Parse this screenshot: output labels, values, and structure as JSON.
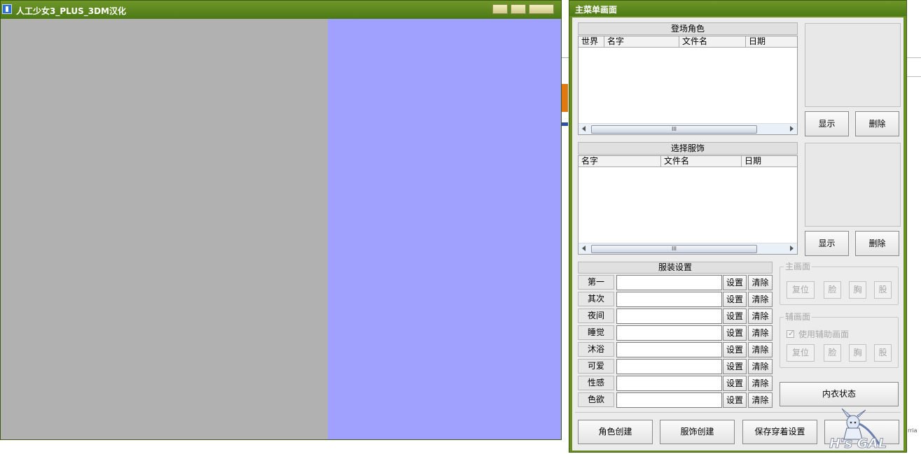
{
  "game_window": {
    "title": "人工少女3_PLUS_3DM汉化",
    "panes": {
      "left_color": "#b1b1b1",
      "right_color": "#a0a0ff"
    }
  },
  "menu_window": {
    "title": "主菜单画面",
    "characters": {
      "header": "登场角色",
      "columns": [
        "世界",
        "名字",
        "文件名",
        "日期"
      ],
      "rows": [],
      "show_button": "显示",
      "delete_button": "删除"
    },
    "outfits": {
      "header": "选择服饰",
      "columns": [
        "名字",
        "文件名",
        "日期"
      ],
      "rows": [],
      "show_button": "显示",
      "delete_button": "删除"
    },
    "clothing_settings": {
      "header": "服装设置",
      "set_label": "设置",
      "clear_label": "清除",
      "rows": [
        {
          "label": "第一",
          "value": ""
        },
        {
          "label": "其次",
          "value": ""
        },
        {
          "label": "夜间",
          "value": ""
        },
        {
          "label": "睡觉",
          "value": ""
        },
        {
          "label": "沐浴",
          "value": ""
        },
        {
          "label": "可爱",
          "value": ""
        },
        {
          "label": "性感",
          "value": ""
        },
        {
          "label": "色欲",
          "value": ""
        }
      ]
    },
    "main_view": {
      "legend": "主画面",
      "buttons": [
        "复位",
        "脸",
        "胸",
        "股"
      ]
    },
    "aux_view": {
      "legend": "辅画面",
      "checkbox_label": "使用辅助画面",
      "checkbox_checked": true,
      "buttons": [
        "复位",
        "脸",
        "胸",
        "股"
      ]
    },
    "underwear_button": "内衣状态",
    "bottom_buttons": {
      "create_character": "角色创建",
      "create_outfit": "服饰创建",
      "save_wear": "保存穿着设置"
    },
    "logo_text": "H's GAL"
  },
  "background_text": "rria",
  "colors": {
    "titlebar": "#5a7e1e",
    "dialog_bg": "#ececec"
  }
}
